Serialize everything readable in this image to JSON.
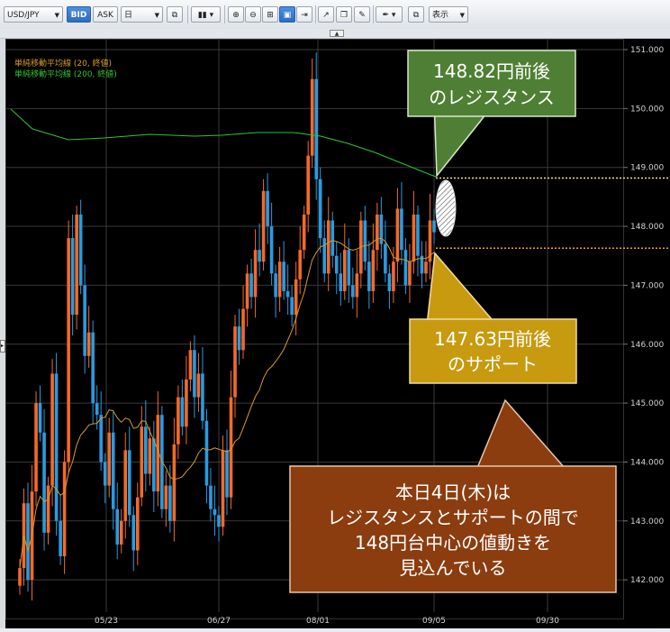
{
  "toolbar": {
    "symbol": "USD/JPY",
    "bid": "BID",
    "ask": "ASK",
    "period": "日",
    "display": "表示",
    "icons": [
      "compare-icon",
      "candle-type-icon",
      "zoom-in-icon",
      "zoom-out-icon",
      "grid-icon",
      "panel-icon",
      "scroll-right-icon",
      "export-icon",
      "copy-icon",
      "annotate-icon",
      "draw-pen-icon",
      "window-icon"
    ]
  },
  "legend": {
    "ma20": "単純移動平均線 (20, 終値)",
    "ma200": "単純移動平均線 (200, 終値)"
  },
  "axis": {
    "y_ticks": [
      "151.000",
      "150.000",
      "149.000",
      "148.000",
      "147.000",
      "146.000",
      "145.000",
      "144.000",
      "143.000",
      "142.000"
    ],
    "x_ticks": [
      "05/23",
      "06/27",
      "08/01",
      "09/05",
      "09/30"
    ]
  },
  "callouts": {
    "resistance": {
      "line1": "148.82円前後",
      "line2": "のレジスタンス",
      "level": 148.82
    },
    "support": {
      "line1": "147.63円前後",
      "line2": "のサポート",
      "level": 147.63
    },
    "outlook": {
      "line1": "本日4日(木)は",
      "line2": "レジスタンスとサポートの間で",
      "line3": "148円台中心の値動きを",
      "line4": "見込んでいる"
    }
  },
  "colors": {
    "up": "#f26a2a",
    "down": "#2a9be0",
    "ma20": "#d79a2c",
    "ma200": "#2fc42f",
    "resistance_box": "#4f7f34",
    "support_box": "#c79a10",
    "outlook_box": "#8b3d0f"
  },
  "chart_data": {
    "type": "candlestick",
    "symbol": "USD/JPY",
    "ylim": [
      141.8,
      151.3
    ],
    "x": [
      "05/23",
      "06/27",
      "08/01",
      "09/05",
      "09/30"
    ],
    "series": [
      {
        "name": "単純移動平均線 (20, 終値)"
      },
      {
        "name": "単純移動平均線 (200, 終値)"
      }
    ],
    "resistance": 148.82,
    "support": 147.63,
    "last_close": 147.95
  }
}
